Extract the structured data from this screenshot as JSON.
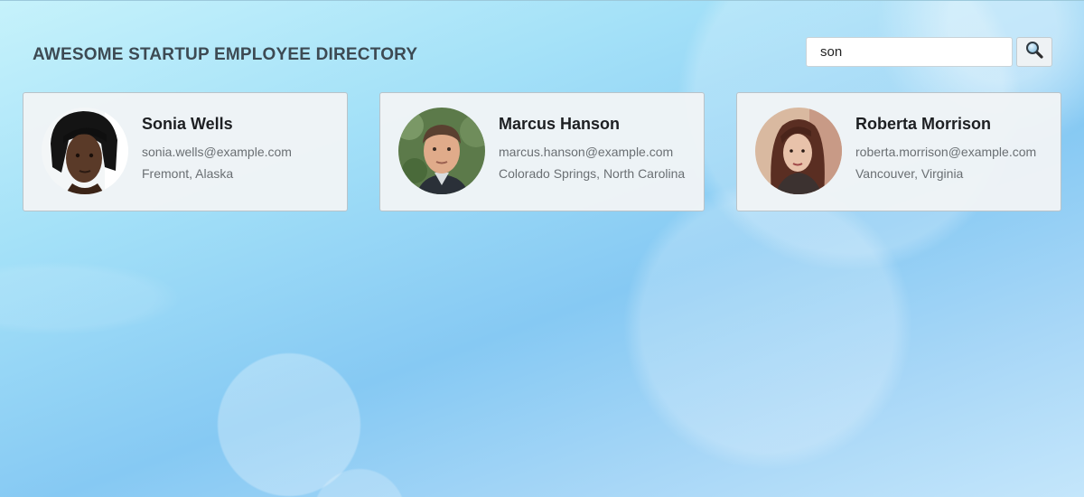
{
  "header": {
    "title": "AWESOME STARTUP EMPLOYEE DIRECTORY"
  },
  "search": {
    "value": "son",
    "button_icon": "search-icon"
  },
  "employees": [
    {
      "name": "Sonia Wells",
      "email": "sonia.wells@example.com",
      "location": "Fremont, Alaska",
      "avatar": "avatar-photo"
    },
    {
      "name": "Marcus Hanson",
      "email": "marcus.hanson@example.com",
      "location": "Colorado Springs, North Carolina",
      "avatar": "avatar-photo"
    },
    {
      "name": "Roberta Morrison",
      "email": "roberta.morrison@example.com",
      "location": "Vancouver, Virginia",
      "avatar": "avatar-photo"
    }
  ],
  "colors": {
    "title": "#3d4a53",
    "card_bg": "#f0f4f6",
    "name": "#1d1f22",
    "detail": "#6a6f73"
  }
}
